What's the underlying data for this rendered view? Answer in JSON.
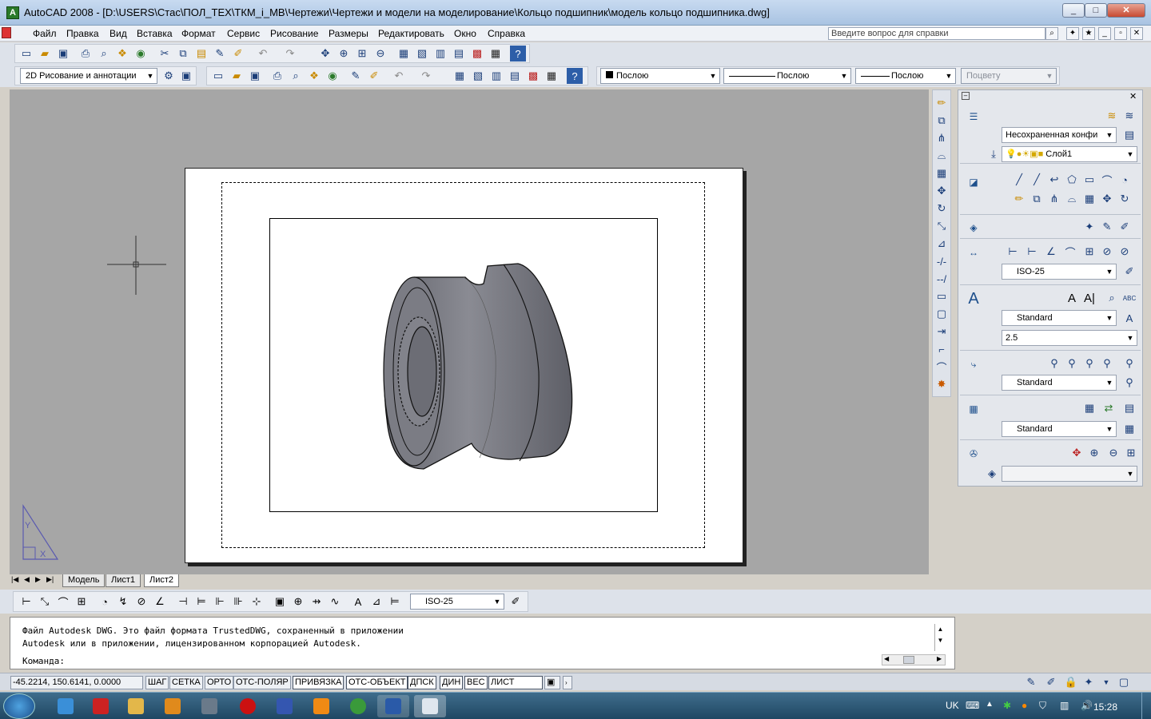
{
  "window": {
    "title": "AutoCAD 2008 - [D:\\USERS\\Стас\\ПОЛ_ТЕХ\\ТКМ_i_МВ\\Чертежи\\Чертежи и модели на моделирование\\Кольцо подшипник\\модель кольцо подшипника.dwg]",
    "minimize": "_",
    "maximize": "□",
    "close": "✕"
  },
  "menu": {
    "items": [
      "Файл",
      "Правка",
      "Вид",
      "Вставка",
      "Формат",
      "Сервис",
      "Рисование",
      "Размеры",
      "Редактировать",
      "Окно",
      "Справка"
    ],
    "help_placeholder": "Введите вопрос для справки"
  },
  "toolbar2": {
    "workspace": "2D Рисование и аннотации",
    "color": "Послою",
    "linetype": "Послою",
    "lineweight": "Послою",
    "plotstyle": "Поцвету"
  },
  "dashboard": {
    "layer_state": "Несохраненная конфи",
    "layer": "Слой1",
    "dim_style": "ISO-25",
    "text_style": "Standard",
    "text_height": "2.5",
    "mleader_style": "Standard",
    "table_style": "Standard"
  },
  "tabs": [
    "Модель",
    "Лист1",
    "Лист2"
  ],
  "active_tab": "Лист2",
  "dim_toolbar": {
    "style": "ISO-25"
  },
  "command": {
    "line1": "Файл Autodesk DWG. Это файл формата TrustedDWG, сохраненный в приложении",
    "line2": "Autodesk или в приложении, лицензированном корпорацией Autodesk.",
    "prompt": "Команда:"
  },
  "status": {
    "coords": "-45.2214, 150.6141, 0.0000",
    "buttons": [
      "ШАГ",
      "СЕТКА",
      "ОРТО",
      "ОТС-ПОЛЯР",
      "ПРИВЯЗКА",
      "ОТС-ОБЪЕКТ",
      "ДПСК",
      "ДИН",
      "ВЕС",
      "ЛИСТ"
    ],
    "active": [
      "ПРИВЯЗКА",
      "ОТС-ОБЪЕКТ",
      "ДПСК",
      "ДИН",
      "ВЕС",
      "ЛИСТ"
    ]
  },
  "ucs": {
    "y": "Y",
    "x": "X"
  },
  "taskbar": {
    "lang": "UK",
    "time": "15:28"
  },
  "colors": {
    "drawing_bg": "#a6a6a6",
    "paper": "#ffffff",
    "model_fill": "#75767f"
  }
}
